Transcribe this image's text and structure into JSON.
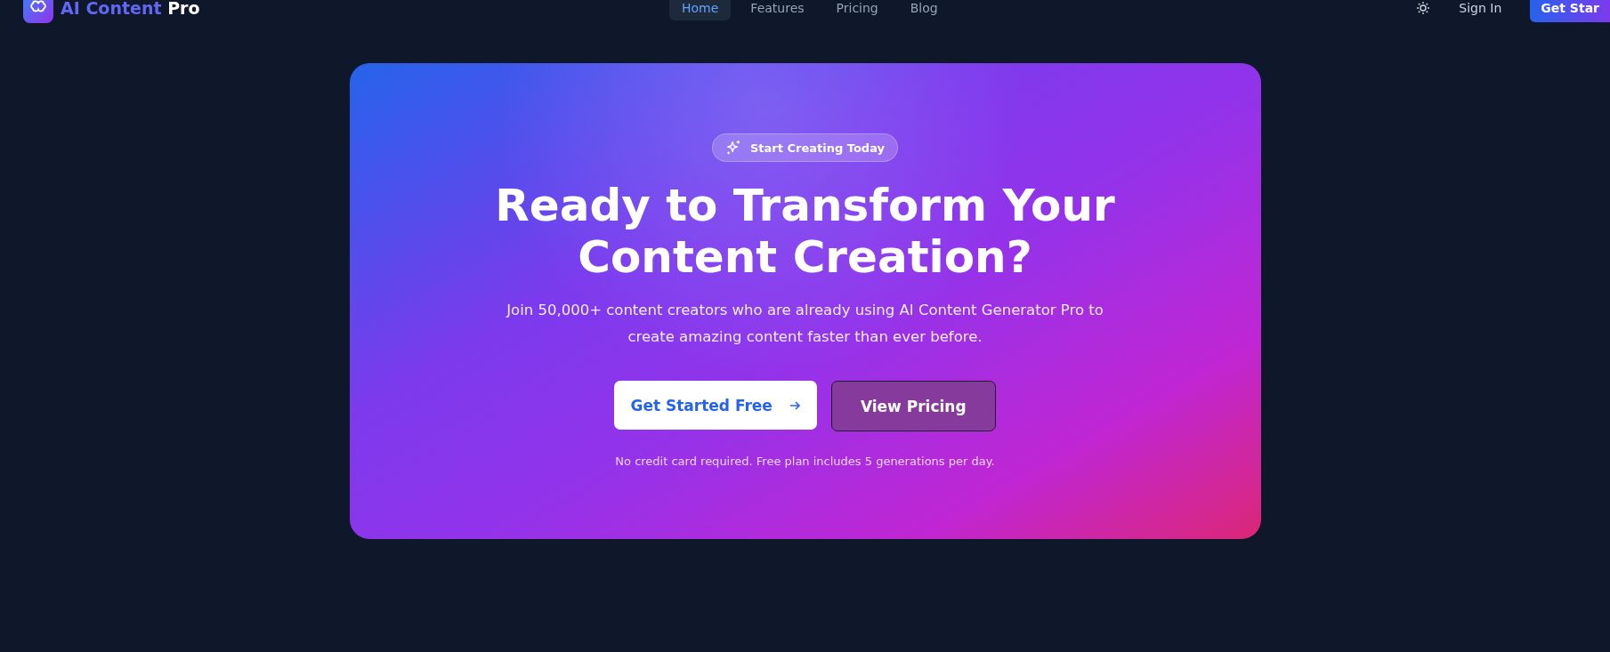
{
  "header": {
    "logo": {
      "first": "AI Content",
      "second": "Pro"
    },
    "nav": [
      {
        "label": "Home",
        "selected": true
      },
      {
        "label": "Features",
        "selected": false
      },
      {
        "label": "Pricing",
        "selected": false
      },
      {
        "label": "Blog",
        "selected": false
      }
    ],
    "sign_in": "Sign In",
    "cta": "Get Star"
  },
  "hero": {
    "badge": "Start Creating Today",
    "title_lines": [
      "Ready to Transform Your",
      "Content Creation?"
    ],
    "lines": [
      "Join 50,000+ content creators who are already using AI Content Generator Pro to",
      "create amazing content faster than ever before."
    ],
    "primary_button": "Get Started Free",
    "secondary_button": "View Pricing",
    "note": "No credit card required. Free plan includes 5 generations per day."
  }
}
